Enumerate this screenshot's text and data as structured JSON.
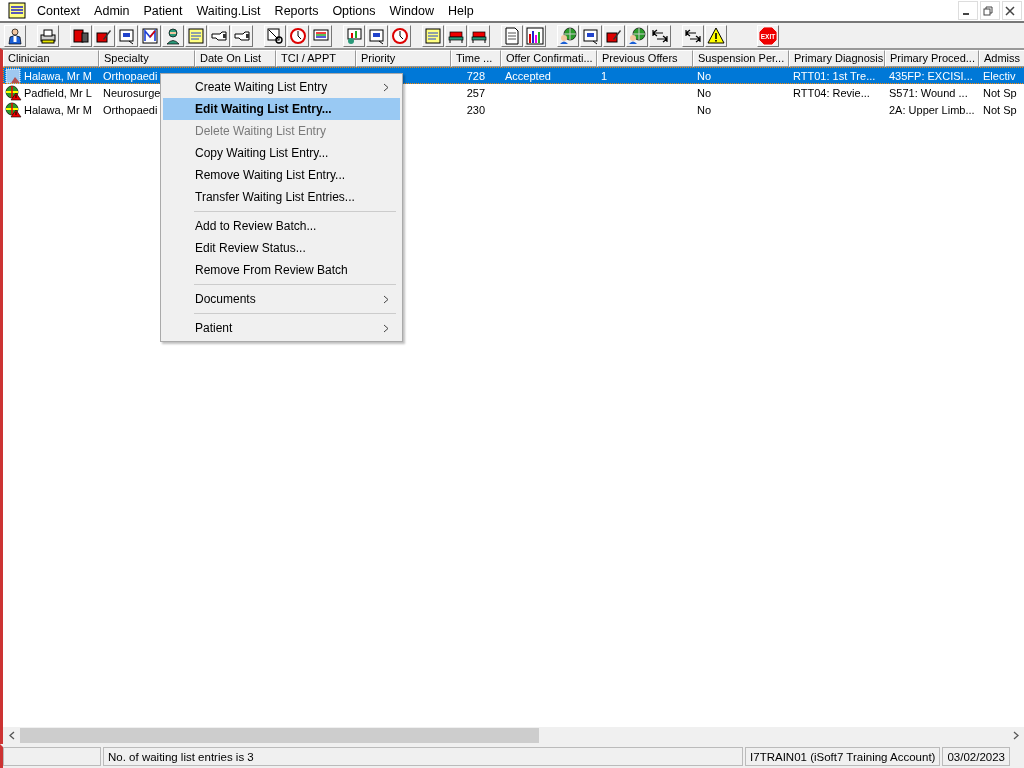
{
  "menu_bar": {
    "items": [
      "Context",
      "Admin",
      "Patient",
      "Waiting.List",
      "Reports",
      "Options",
      "Window",
      "Help"
    ]
  },
  "toolbar": {
    "exit_label": "EXIT"
  },
  "table": {
    "columns": [
      "Clinician",
      "Specialty",
      "Date On List",
      "TCI / APPT",
      "Priority",
      "Time ...",
      "Offer Confirmati...",
      "Previous Offers",
      "Suspension Per...",
      "Primary Diagnosis",
      "Primary Proced...",
      "Admiss"
    ],
    "rows": [
      {
        "selected": true,
        "cells": [
          "Halawa, Mr M",
          "Orthopaedi",
          null,
          null,
          null,
          "728",
          "Accepted",
          "1",
          "No",
          "RTT01: 1st Tre...",
          "435FP: EXCISI...",
          "Electiv"
        ]
      },
      {
        "selected": false,
        "cells": [
          "Padfield, Mr L",
          "Neurosurge",
          null,
          null,
          null,
          "257",
          null,
          null,
          "No",
          "RTT04: Revie...",
          "S571: Wound ...",
          "Not Sp"
        ]
      },
      {
        "selected": false,
        "cells": [
          "Halawa, Mr M",
          "Orthopaedi",
          null,
          null,
          null,
          "230",
          null,
          null,
          "No",
          null,
          "2A: Upper Limb...",
          "Not Sp"
        ]
      }
    ]
  },
  "context_menu": {
    "items": [
      {
        "kind": "item",
        "label": "Create Waiting List Entry",
        "submenu": true,
        "disabled": false,
        "selected": false
      },
      {
        "kind": "item",
        "label": "Edit Waiting List Entry...",
        "submenu": false,
        "disabled": false,
        "selected": true
      },
      {
        "kind": "item",
        "label": "Delete Waiting List Entry",
        "submenu": false,
        "disabled": true,
        "selected": false
      },
      {
        "kind": "item",
        "label": "Copy Waiting List Entry...",
        "submenu": false,
        "disabled": false,
        "selected": false
      },
      {
        "kind": "item",
        "label": "Remove Waiting List Entry...",
        "submenu": false,
        "disabled": false,
        "selected": false
      },
      {
        "kind": "item",
        "label": "Transfer Waiting List Entries...",
        "submenu": false,
        "disabled": false,
        "selected": false
      },
      {
        "kind": "separator"
      },
      {
        "kind": "item",
        "label": "Add to Review Batch...",
        "submenu": false,
        "disabled": false,
        "selected": false
      },
      {
        "kind": "item",
        "label": "Edit Review Status...",
        "submenu": false,
        "disabled": false,
        "selected": false
      },
      {
        "kind": "item",
        "label": "Remove From Review Batch",
        "submenu": false,
        "disabled": false,
        "selected": false
      },
      {
        "kind": "separator"
      },
      {
        "kind": "item",
        "label": "Documents",
        "submenu": true,
        "disabled": false,
        "selected": false
      },
      {
        "kind": "separator"
      },
      {
        "kind": "item",
        "label": "Patient",
        "submenu": true,
        "disabled": false,
        "selected": false
      }
    ]
  },
  "status_bar": {
    "panels": [
      "No. of waiting list entries is 3",
      "I7TRAIN01 (iSoft7 Training Account)",
      "03/02/2023"
    ]
  }
}
